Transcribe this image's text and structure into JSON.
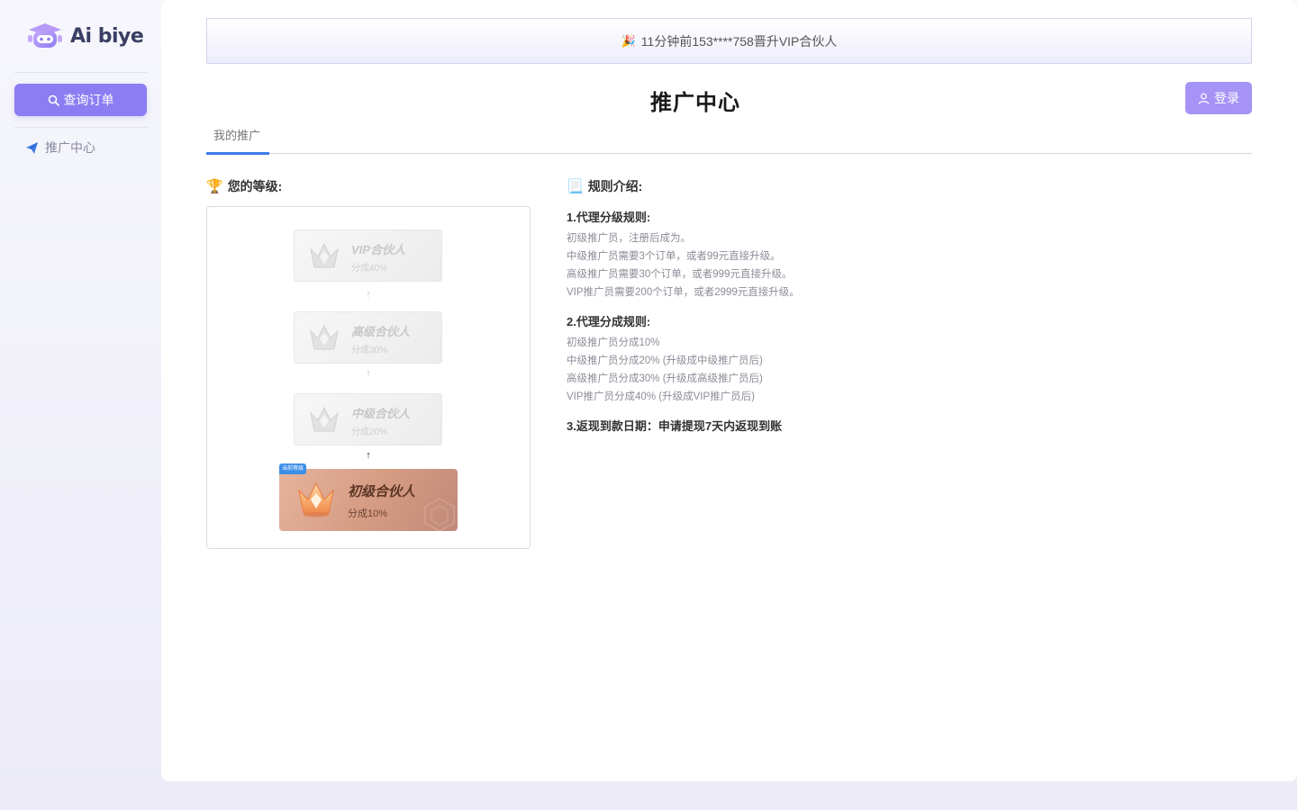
{
  "sidebar": {
    "logo_text": "Ai biye",
    "query_button": "查询订单",
    "nav_items": [
      {
        "label": "推广中心",
        "icon": "paper-plane-icon"
      }
    ]
  },
  "notice": {
    "icon": "party-popper-icon",
    "text": "11分钟前153****758晋升VIP合伙人"
  },
  "header": {
    "title": "推广中心",
    "login_button": "登录"
  },
  "tabs": [
    {
      "label": "我的推广",
      "active": true
    }
  ],
  "level_section": {
    "title": "您的等级:",
    "icon": "trophy-icon",
    "levels": [
      {
        "name": "VIP合伙人",
        "share": "分成40%",
        "current": false
      },
      {
        "name": "高级合伙人",
        "share": "分成30%",
        "current": false
      },
      {
        "name": "中级合伙人",
        "share": "分成20%",
        "current": false
      },
      {
        "name": "初级合伙人",
        "share": "分成10%",
        "current": true
      }
    ],
    "current_badge": "当前等级",
    "arrow": "↑"
  },
  "rules_section": {
    "title": "规则介绍:",
    "icon": "scroll-icon",
    "blocks": [
      {
        "heading": "1.代理分级规则:",
        "lines": [
          "初级推广员，注册后成为。",
          "中级推广员需要3个订单，或者99元直接升级。",
          "高级推广员需要30个订单，或者999元直接升级。",
          "VIP推广员需要200个订单，或者2999元直接升级。"
        ]
      },
      {
        "heading": "2.代理分成规则:",
        "lines": [
          "初级推广员分成10%",
          "中级推广员分成20% (升级成中级推广员后)",
          "高级推广员分成30% (升级成高级推广员后)",
          "VIP推广员分成40% (升级成VIP推广员后)"
        ]
      },
      {
        "heading": "3.返现到款日期：申请提现7天内返现到账",
        "lines": []
      }
    ]
  },
  "colors": {
    "accent": "#8c7df2",
    "login": "#a693f6",
    "tab_active": "#3e7be8",
    "current_badge": "#3b8fe8"
  }
}
